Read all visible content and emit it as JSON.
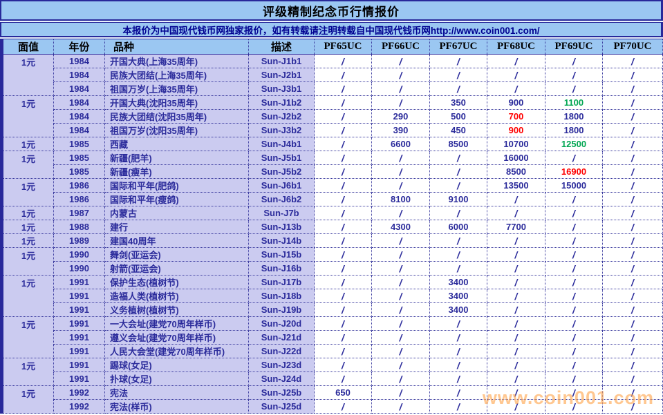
{
  "page": {
    "title": "评级精制纪念币行情报价",
    "subtitle": "本报价为中国现代钱币网独家报价，如有转载请注明转载自中国现代钱币网http://www.coin001.com/",
    "watermark": "www.coin001.com"
  },
  "colors": {
    "banner_bg": "#9BC7F2",
    "row_label_bg": "#CBCBF0",
    "value_bg": "#FFFFFF",
    "text_navy": "#2B2B9B",
    "subtitle_navy": "#000090",
    "border_navy": "#3A3A9E",
    "price_red": "#FF0000",
    "price_green": "#00A651",
    "watermark_orange": "#FFA64D"
  },
  "table": {
    "headers": [
      "面值",
      "年份",
      "品种",
      "描述",
      "PF65UC",
      "PF66UC",
      "PF67UC",
      "PF68UC",
      "PF69UC",
      "PF70UC"
    ],
    "rows": [
      {
        "fv": "1元",
        "year": "1984",
        "variety": "开国大典(上海35周年)",
        "desc": "Sun-J1b1",
        "prices": [
          "/",
          "/",
          "/",
          "/",
          "/",
          "/"
        ],
        "group_end": false
      },
      {
        "fv": "",
        "year": "1984",
        "variety": "民族大团结(上海35周年)",
        "desc": "Sun-J2b1",
        "prices": [
          "/",
          "/",
          "/",
          "/",
          "/",
          "/"
        ],
        "group_end": false
      },
      {
        "fv": "",
        "year": "1984",
        "variety": "祖国万岁(上海35周年)",
        "desc": "Sun-J3b1",
        "prices": [
          "/",
          "/",
          "/",
          "/",
          "/",
          "/"
        ],
        "group_end": true
      },
      {
        "fv": "1元",
        "year": "1984",
        "variety": "开国大典(沈阳35周年)",
        "desc": "Sun-J1b2",
        "prices": [
          "/",
          "/",
          "350",
          "900",
          {
            "v": "1100",
            "color": "green"
          },
          "/"
        ],
        "group_end": false
      },
      {
        "fv": "",
        "year": "1984",
        "variety": "民族大团结(沈阳35周年)",
        "desc": "Sun-J2b2",
        "prices": [
          "/",
          "290",
          "500",
          {
            "v": "700",
            "color": "red"
          },
          "1800",
          "/"
        ],
        "group_end": false
      },
      {
        "fv": "",
        "year": "1984",
        "variety": "祖国万岁(沈阳35周年)",
        "desc": "Sun-J3b2",
        "prices": [
          "/",
          "390",
          "450",
          {
            "v": "900",
            "color": "red"
          },
          "1800",
          "/"
        ],
        "group_end": true
      },
      {
        "fv": "1元",
        "year": "1985",
        "variety": "西藏",
        "desc": "Sun-J4b1",
        "prices": [
          "/",
          "6600",
          "8500",
          "10700",
          {
            "v": "12500",
            "color": "green"
          },
          "/"
        ],
        "group_end": true
      },
      {
        "fv": "1元",
        "year": "1985",
        "variety": "新疆(肥羊)",
        "desc": "Sun-J5b1",
        "prices": [
          "/",
          "/",
          "/",
          "16000",
          "/",
          "/"
        ],
        "group_end": false
      },
      {
        "fv": "",
        "year": "1985",
        "variety": "新疆(瘦羊)",
        "desc": "Sun-J5b2",
        "prices": [
          "/",
          "/",
          "/",
          "8500",
          {
            "v": "16900",
            "color": "red"
          },
          "/"
        ],
        "group_end": true
      },
      {
        "fv": "1元",
        "year": "1986",
        "variety": "国际和平年(肥鸽)",
        "desc": "Sun-J6b1",
        "prices": [
          "/",
          "/",
          "/",
          "13500",
          "15000",
          "/"
        ],
        "group_end": false
      },
      {
        "fv": "",
        "year": "1986",
        "variety": "国际和平年(瘦鸽)",
        "desc": "Sun-J6b2",
        "prices": [
          "/",
          "8100",
          "9100",
          "/",
          "/",
          "/"
        ],
        "group_end": true
      },
      {
        "fv": "1元",
        "year": "1987",
        "variety": "内蒙古",
        "desc": "Sun-J7b",
        "prices": [
          "/",
          "/",
          "/",
          "/",
          "/",
          "/"
        ],
        "group_end": true
      },
      {
        "fv": "1元",
        "year": "1988",
        "variety": "建行",
        "desc": "Sun-J13b",
        "prices": [
          "/",
          "4300",
          "6000",
          "7700",
          "/",
          "/"
        ],
        "group_end": true
      },
      {
        "fv": "1元",
        "year": "1989",
        "variety": "建国40周年",
        "desc": "Sun-J14b",
        "prices": [
          "/",
          "/",
          "/",
          "/",
          "/",
          "/"
        ],
        "group_end": true
      },
      {
        "fv": "1元",
        "year": "1990",
        "variety": "舞剑(亚运会)",
        "desc": "Sun-J15b",
        "prices": [
          "/",
          "/",
          "/",
          "/",
          "/",
          "/"
        ],
        "group_end": false
      },
      {
        "fv": "",
        "year": "1990",
        "variety": "射箭(亚运会)",
        "desc": "Sun-J16b",
        "prices": [
          "/",
          "/",
          "/",
          "/",
          "/",
          "/"
        ],
        "group_end": true
      },
      {
        "fv": "1元",
        "year": "1991",
        "variety": "保护生态(植树节)",
        "desc": "Sun-J17b",
        "prices": [
          "/",
          "/",
          "3400",
          "/",
          "/",
          "/"
        ],
        "group_end": false
      },
      {
        "fv": "",
        "year": "1991",
        "variety": "造福人类(植树节)",
        "desc": "Sun-J18b",
        "prices": [
          "/",
          "/",
          "3400",
          "/",
          "/",
          "/"
        ],
        "group_end": false
      },
      {
        "fv": "",
        "year": "1991",
        "variety": "义务植树(植树节)",
        "desc": "Sun-J19b",
        "prices": [
          "/",
          "/",
          "3400",
          "/",
          "/",
          "/"
        ],
        "group_end": true
      },
      {
        "fv": "1元",
        "year": "1991",
        "variety": "一大会址(建党70周年样币)",
        "desc": "Sun-J20d",
        "prices": [
          "/",
          "/",
          "/",
          "/",
          "/",
          "/"
        ],
        "group_end": false
      },
      {
        "fv": "",
        "year": "1991",
        "variety": "遵义会址(建党70周年样币)",
        "desc": "Sun-J21d",
        "prices": [
          "/",
          "/",
          "/",
          "/",
          "/",
          "/"
        ],
        "group_end": false
      },
      {
        "fv": "",
        "year": "1991",
        "variety": "人民大会堂(建党70周年样币)",
        "desc": "Sun-J22d",
        "prices": [
          "/",
          "/",
          "/",
          "/",
          "/",
          "/"
        ],
        "group_end": true
      },
      {
        "fv": "1元",
        "year": "1991",
        "variety": "踢球(女足)",
        "desc": "Sun-J23d",
        "prices": [
          "/",
          "/",
          "/",
          "/",
          "/",
          "/"
        ],
        "group_end": false
      },
      {
        "fv": "",
        "year": "1991",
        "variety": "扑球(女足)",
        "desc": "Sun-J24d",
        "prices": [
          "/",
          "/",
          "/",
          "/",
          "/",
          "/"
        ],
        "group_end": true
      },
      {
        "fv": "1元",
        "year": "1992",
        "variety": "宪法",
        "desc": "Sun-J25b",
        "prices": [
          "650",
          "/",
          "/",
          "/",
          "/",
          "/"
        ],
        "group_end": false
      },
      {
        "fv": "",
        "year": "1992",
        "variety": "宪法(样币)",
        "desc": "Sun-J25d",
        "prices": [
          "/",
          "/",
          "/",
          "/",
          "/",
          "/"
        ],
        "group_end": true
      }
    ]
  }
}
